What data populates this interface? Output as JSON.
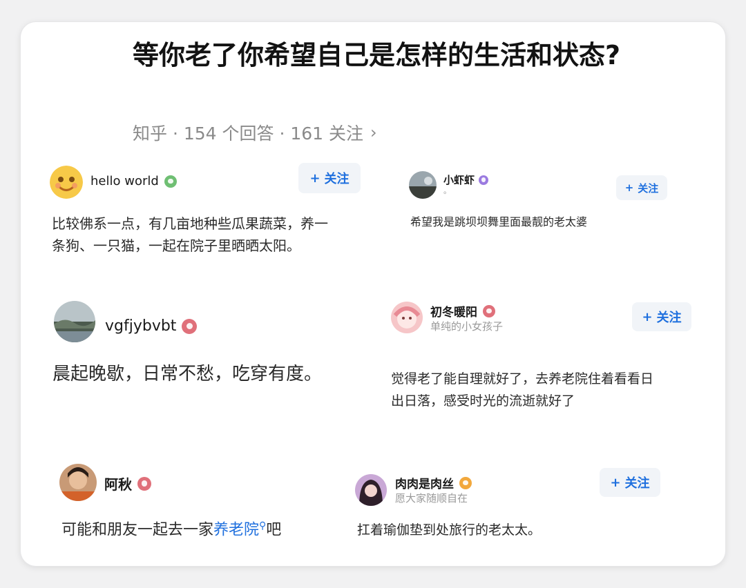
{
  "question": {
    "title": "等你老了你希望自己是怎样的生活和状态?",
    "meta": "知乎 · 154 个回答 · 161 关注",
    "chevron": "›"
  },
  "follow_label": "关注",
  "follow_plus": "+",
  "answers": [
    {
      "author": "hello world",
      "badge": "green",
      "answer_lines": [
        "比较佛系一点，有几亩地种些瓜果蔬菜，养一",
        "条狗、一只猫，一起在院子里晒晒太阳。"
      ]
    },
    {
      "author": "小虾虾",
      "badge": "purple",
      "bio": "。",
      "answer": "希望我是跳坝坝舞里面最靓的老太婆"
    },
    {
      "author": "vgfjybvbt",
      "badge": "red",
      "answer": "晨起晚歇，日常不愁，吃穿有度。"
    },
    {
      "author": "初冬暖阳",
      "badge": "red",
      "bio": "单纯的小女孩子",
      "answer_lines": [
        "觉得老了能自理就好了，去养老院住着看看日",
        "出日落，感受时光的流逝就好了"
      ]
    },
    {
      "author": "阿秋",
      "badge": "red",
      "answer_prefix": "可能和朋友一起去一家",
      "answer_link": "养老院",
      "answer_suffix": "吧"
    },
    {
      "author": "肉肉是肉丝",
      "badge": "orange",
      "bio": "愿大家随顺自在",
      "answer": "扛着瑜伽垫到处旅行的老太太。"
    }
  ],
  "colors": {
    "accent_blue": "#1e6fde",
    "follow_bg": "#f1f4f8",
    "meta_gray": "#8a8a8a"
  }
}
